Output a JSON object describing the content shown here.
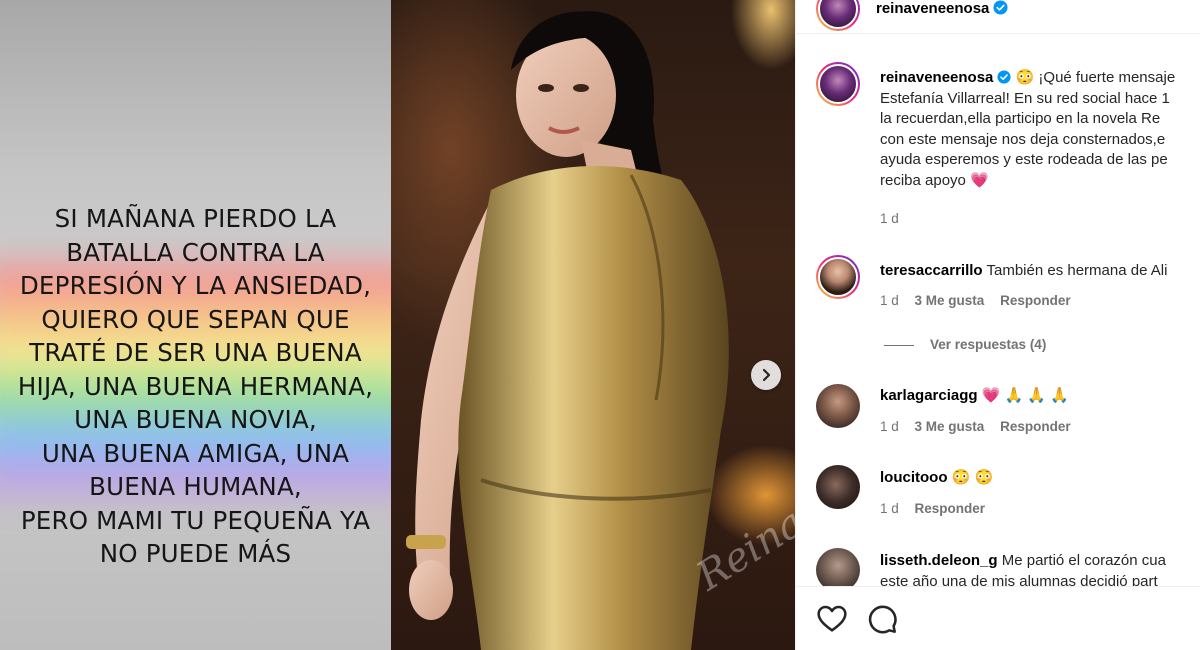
{
  "post": {
    "story_lines": [
      "SI MAÑANA PIERDO LA",
      "BATALLA CONTRA LA",
      "DEPRESIÓN Y LA ANSIEDAD,",
      "QUIERO QUE SEPAN QUE",
      "TRATÉ DE SER UNA BUENA",
      "HIJA, UNA BUENA HERMANA,",
      "UNA BUENA NOVIA,",
      "UNA BUENA AMIGA, UNA",
      "BUENA HUMANA,",
      "PERO MAMI  TU PEQUEÑA YA",
      "NO PUEDE MÁS"
    ],
    "watermark": "Reinaveneenosa",
    "next_icon": "chevron-right-icon"
  },
  "header": {
    "username": "reinaveneenosa",
    "verified_icon": "verified-badge-icon"
  },
  "caption": {
    "username": "reinaveneenosa",
    "lines": [
      "😳 ¡Qué fuerte mensaje",
      "Estefanía Villarreal! En su red social hace 1",
      "la recuerdan,ella participo en la novela Re",
      "con este mensaje nos deja consternados,e",
      "ayuda esperemos y este rodeada de las pe",
      "reciba apoyo 💗"
    ],
    "time": "1 d"
  },
  "comments": [
    {
      "username": "teresaccarrillo",
      "text": "También es hermana de Ali",
      "time": "1 d",
      "likes": "3 Me gusta",
      "reply": "Responder",
      "view_replies": "Ver respuestas (4)"
    },
    {
      "username": "karlagarciagg",
      "text": "💗 🙏 🙏 🙏",
      "time": "1 d",
      "likes": "3 Me gusta",
      "reply": "Responder"
    },
    {
      "username": "loucitooo",
      "text": "😳 😳",
      "time": "1 d",
      "reply": "Responder"
    },
    {
      "username": "lisseth.deleon_g",
      "text": "Me partió el corazón cua",
      "text_line2": "este año una de mis alumnas decidió part"
    }
  ],
  "actions": {
    "like_icon": "heart-icon",
    "comment_icon": "comment-icon"
  },
  "colors": {
    "text": "#262626",
    "secondary": "#737373",
    "verified": "#0095f6",
    "border": "#efefef"
  }
}
